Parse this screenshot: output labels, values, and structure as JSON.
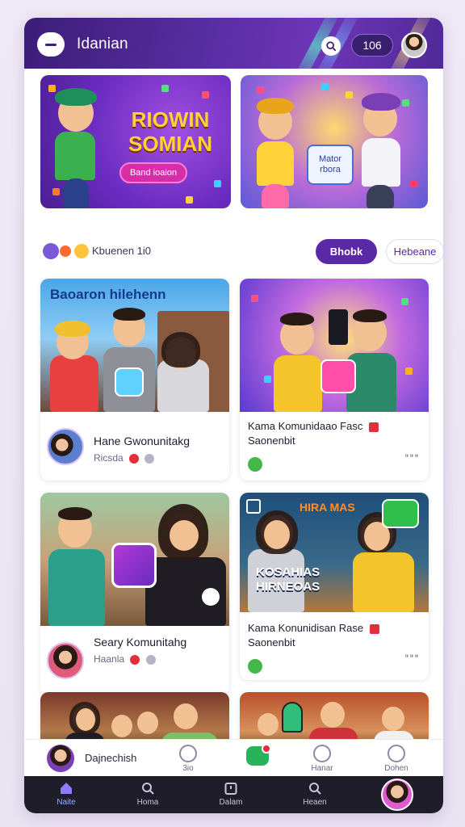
{
  "header": {
    "title": "Idanian",
    "count_badge": "106"
  },
  "hero": {
    "left": {
      "title": "RIOWIN SOMIAN",
      "cta": "Band ioaion"
    },
    "right": {
      "badge": "Mator rbora"
    }
  },
  "action_row": {
    "label": "Kbuenen 1i0",
    "primary_button": "Bhobk",
    "secondary_button": "Hebeane"
  },
  "cards": [
    {
      "overlay": "Baoaron hilehenn",
      "title": "Hane Gwonunitakg",
      "meta": "Ricsda"
    },
    {
      "title": "Kama Komunidaao Fasc",
      "subtitle": "Saonenbit",
      "more": "⁍⁍⁍"
    },
    {
      "title": "Seary Komunitahg",
      "meta": "Haanla"
    },
    {
      "overlay": "HIRA MAS",
      "banner": "KOSAHIAS HIRNEOAS",
      "title": "Kama Konunidisan Rase",
      "subtitle": "Saonenbit",
      "more": "⁍⁍⁍"
    }
  ],
  "mini_bar": {
    "label": "Dajnechish",
    "item1": "3io",
    "item2": "Hanar",
    "item3": "Dohen"
  },
  "bottom_nav": {
    "items": [
      "Naite",
      "Homa",
      "Dalam",
      "Heaen"
    ]
  },
  "colors": {
    "brand": "#5a2aa6",
    "topbar": "#4a2590",
    "nav_bg": "#1f1d2a",
    "nav_active": "#8fb4ff",
    "notification": "#e2303a"
  }
}
